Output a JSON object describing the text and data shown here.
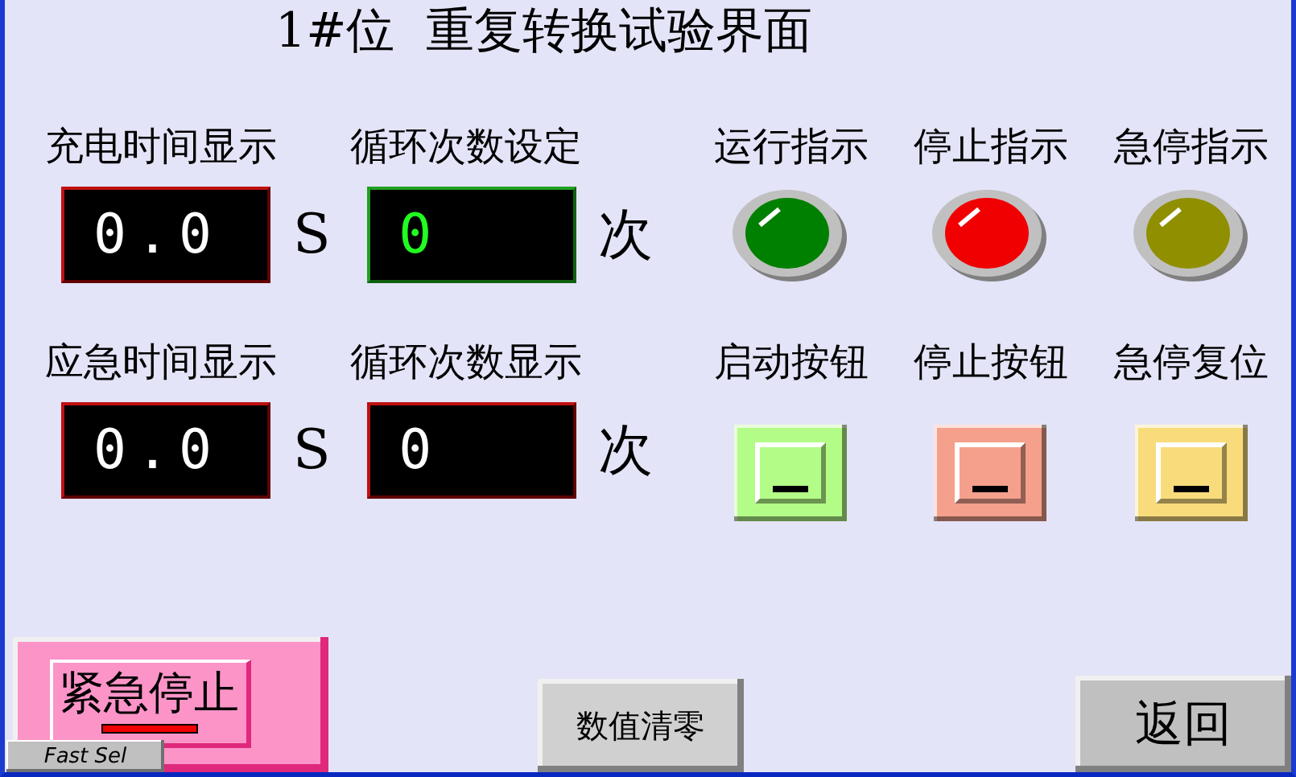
{
  "title": "1#位  重复转换试验界面",
  "displays": [
    {
      "label": "充电时间显示",
      "value": "0.0",
      "unit": "S",
      "kind": "readout"
    },
    {
      "label": "循环次数设定",
      "value": "0",
      "unit": "次",
      "kind": "setpoint"
    },
    {
      "label": "应急时间显示",
      "value": "0.0",
      "unit": "S",
      "kind": "readout"
    },
    {
      "label": "循环次数显示",
      "value": "0",
      "unit": "次",
      "kind": "readout"
    }
  ],
  "indicators": [
    {
      "label": "运行指示",
      "color": "#008000"
    },
    {
      "label": "停止指示",
      "color": "#f00000"
    },
    {
      "label": "急停指示",
      "color": "#908f00"
    }
  ],
  "push_buttons": [
    {
      "label": "启动按钮",
      "color": "#b4fc88"
    },
    {
      "label": "停止按钮",
      "color": "#f4a08c"
    },
    {
      "label": "急停复位",
      "color": "#f8dc7c"
    }
  ],
  "emergency_stop": {
    "label": "紧急停止"
  },
  "fast_sel": "Fast Sel",
  "clear_button": "数值清零",
  "back_button": "返回"
}
